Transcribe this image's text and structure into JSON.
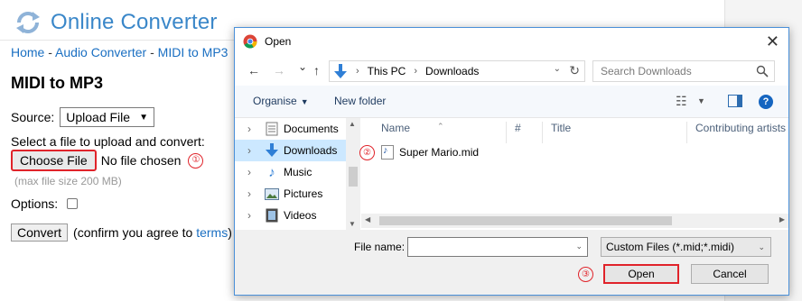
{
  "site": {
    "logo_text": "Online Converter",
    "breadcrumb": [
      "Home",
      "Audio Converter",
      "MIDI to MP3"
    ],
    "breadcrumb_sep": " - ",
    "heading": "MIDI to MP3",
    "source_label": "Source:",
    "source_value": "Upload File",
    "select_prompt": "Select a file to upload and convert:",
    "choose_button": "Choose File",
    "no_file_text": "No file chosen",
    "max_size": "(max file size 200 MB)",
    "options_label": "Options:",
    "convert_button": "Convert",
    "confirm_prefix": "(confirm you agree to ",
    "terms_link": "terms",
    "confirm_suffix": ")"
  },
  "annotations": {
    "step1": "①",
    "step2": "②",
    "step3": "③",
    "color": "#e0232a"
  },
  "dialog": {
    "title": "Open",
    "nav": {
      "back": "←",
      "forward": "→",
      "recent": "⌄",
      "up": "↑"
    },
    "address": [
      "This PC",
      "Downloads"
    ],
    "search_placeholder": "Search Downloads",
    "toolbar": {
      "organise": "Organise",
      "new_folder": "New folder",
      "help": "?"
    },
    "tree": [
      {
        "label": "Documents",
        "icon": "documents-icon",
        "selected": false
      },
      {
        "label": "Downloads",
        "icon": "downloads-icon",
        "selected": true
      },
      {
        "label": "Music",
        "icon": "music-icon",
        "selected": false
      },
      {
        "label": "Pictures",
        "icon": "pictures-icon",
        "selected": false
      },
      {
        "label": "Videos",
        "icon": "videos-icon",
        "selected": false
      }
    ],
    "columns": [
      "Name",
      "#",
      "Title",
      "Contributing artists"
    ],
    "files": [
      {
        "name": "Super Mario.mid",
        "icon": "midi-file-icon"
      }
    ],
    "file_name_label": "File name:",
    "file_name_value": "",
    "filter": "Custom Files (*.mid;*.midi)",
    "open_button": "Open",
    "cancel_button": "Cancel"
  }
}
